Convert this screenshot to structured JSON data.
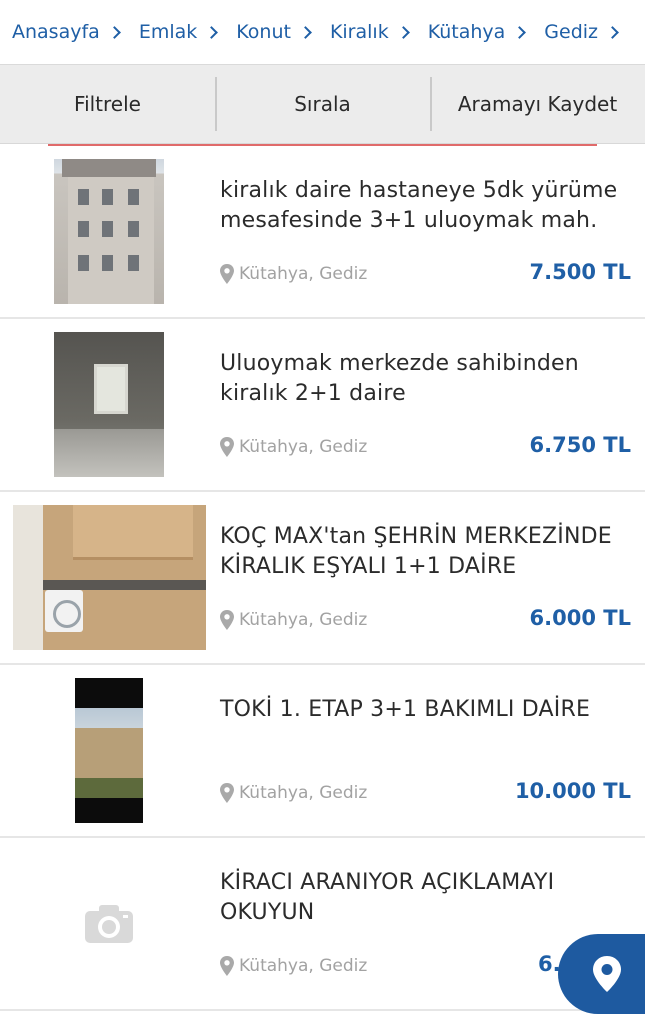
{
  "breadcrumb": [
    "Anasayfa",
    "Emlak",
    "Konut",
    "Kiralık",
    "Kütahya",
    "Gediz"
  ],
  "actions": {
    "filter": "Filtrele",
    "sort": "Sırala",
    "save": "Aramayı Kaydet"
  },
  "listings": [
    {
      "title": "kiralık daire hastaneye 5dk yürüme mesafesinde 3+1 uluoymak mah.",
      "location": "Kütahya, Gediz",
      "price": "7.500 TL"
    },
    {
      "title": "Uluoymak merkezde sahibinden kiralık 2+1 daire",
      "location": "Kütahya, Gediz",
      "price": "6.750 TL"
    },
    {
      "title": "KOÇ MAX'tan ŞEHRİN MERKEZİNDE KİRALIK EŞYALI 1+1 DAİRE",
      "location": "Kütahya, Gediz",
      "price": "6.000 TL"
    },
    {
      "title": "TOKİ 1. ETAP 3+1 BAKIMLI DAİRE",
      "location": "Kütahya, Gediz",
      "price": "10.000 TL"
    },
    {
      "title": "KİRACI ARANIYOR AÇIKLAMAYI OKUYUN",
      "location": "Kütahya, Gediz",
      "price": "6."
    }
  ],
  "colors": {
    "accent": "#1f5fa6",
    "fab": "#1e5aa0",
    "divider": "#e06a6a"
  },
  "icons": {
    "location": "map-pin-icon",
    "no_photo": "camera-icon",
    "map_fab": "map-pin-icon"
  }
}
